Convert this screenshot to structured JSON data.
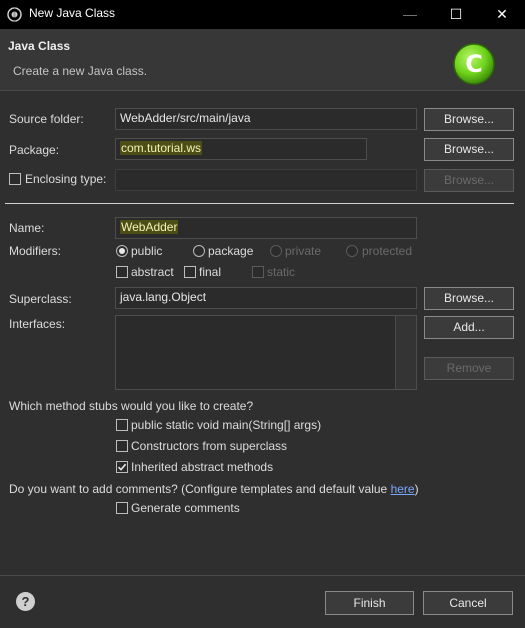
{
  "window": {
    "title": "New Java Class",
    "minimize": "—",
    "maximize": "☐",
    "close": "✕"
  },
  "banner": {
    "title": "Java Class",
    "subtitle": "Create a new Java class.",
    "logo_letter": "C",
    "logo_color": "#6fd41b"
  },
  "form": {
    "source_folder": {
      "label": "Source folder:",
      "value": "WebAdder/src/main/java",
      "browse": "Browse..."
    },
    "package": {
      "label": "Package:",
      "value": "com.tutorial.ws",
      "browse": "Browse..."
    },
    "enclosing_type": {
      "label": "Enclosing type:",
      "value": "",
      "browse": "Browse...",
      "checked": false
    },
    "name": {
      "label": "Name:",
      "value": "WebAdder"
    },
    "modifiers": {
      "label": "Modifiers:",
      "public": "public",
      "package": "package",
      "private": "private",
      "protected": "protected",
      "selected": "public",
      "abstract": "abstract",
      "final": "final",
      "static": "static"
    },
    "superclass": {
      "label": "Superclass:",
      "value": "java.lang.Object",
      "browse": "Browse..."
    },
    "interfaces": {
      "label": "Interfaces:",
      "add": "Add...",
      "remove": "Remove"
    }
  },
  "stubs": {
    "question": "Which method stubs would you like to create?",
    "main": {
      "label": "public static void main(String[] args)",
      "checked": false
    },
    "constructors": {
      "label": "Constructors from superclass",
      "checked": false
    },
    "inherited": {
      "label": "Inherited abstract methods",
      "checked": true
    }
  },
  "comments": {
    "question": "Do you want to add comments? (Configure templates and default value ",
    "link": "here",
    "close_paren": ")",
    "generate": {
      "label": "Generate comments",
      "checked": false
    }
  },
  "footer": {
    "help": "?",
    "finish": "Finish",
    "cancel": "Cancel"
  }
}
